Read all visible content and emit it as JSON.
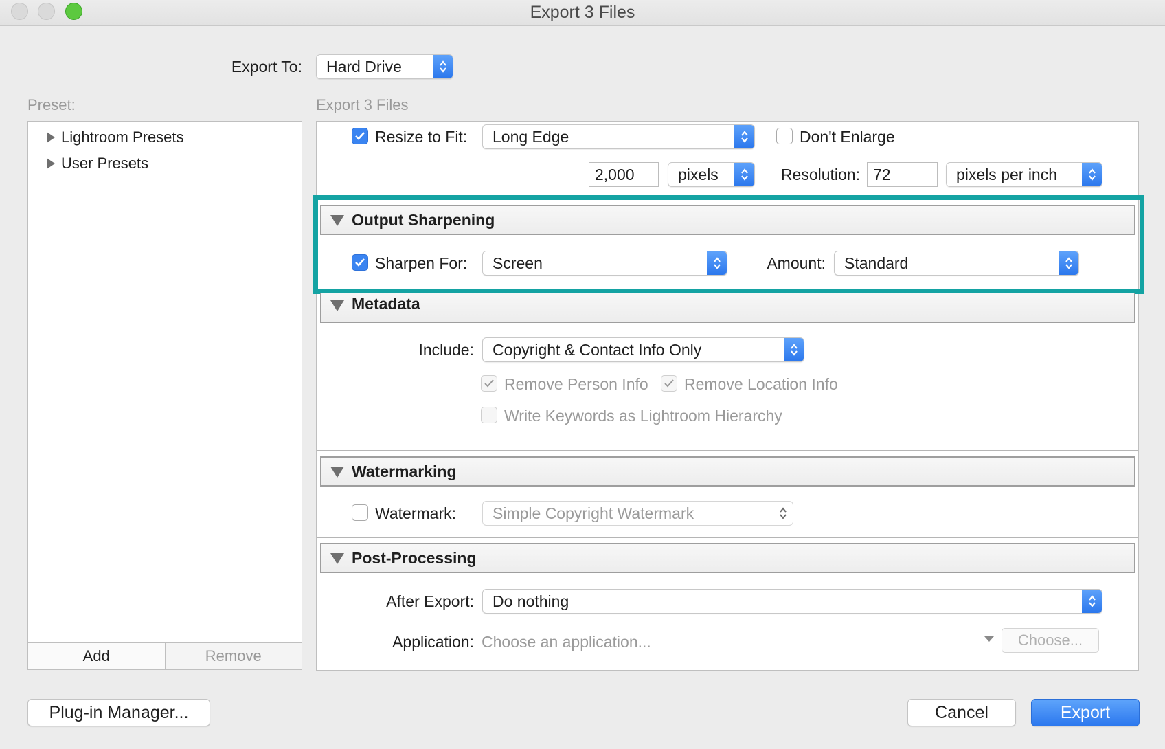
{
  "window": {
    "title": "Export 3 Files"
  },
  "export_to": {
    "label": "Export To:",
    "value": "Hard Drive"
  },
  "preset": {
    "label": "Preset:",
    "items": [
      "Lightroom Presets",
      "User Presets"
    ],
    "add_label": "Add",
    "remove_label": "Remove"
  },
  "main": {
    "header": "Export 3 Files",
    "image_sizing": {
      "resize_label": "Resize to Fit:",
      "resize_checked": true,
      "resize_mode": "Long Edge",
      "dont_enlarge_label": "Don't Enlarge",
      "dont_enlarge_checked": false,
      "size_value": "2,000",
      "size_unit": "pixels",
      "resolution_label": "Resolution:",
      "resolution_value": "72",
      "resolution_unit": "pixels per inch"
    },
    "output_sharpening": {
      "title": "Output Sharpening",
      "sharpen_for_label": "Sharpen For:",
      "sharpen_for_checked": true,
      "sharpen_for_value": "Screen",
      "amount_label": "Amount:",
      "amount_value": "Standard"
    },
    "metadata": {
      "title": "Metadata",
      "include_label": "Include:",
      "include_value": "Copyright & Contact Info Only",
      "remove_person_label": "Remove Person Info",
      "remove_location_label": "Remove Location Info",
      "write_keywords_label": "Write Keywords as Lightroom Hierarchy"
    },
    "watermarking": {
      "title": "Watermarking",
      "watermark_label": "Watermark:",
      "watermark_checked": false,
      "watermark_value": "Simple Copyright Watermark"
    },
    "post_processing": {
      "title": "Post-Processing",
      "after_export_label": "After Export:",
      "after_export_value": "Do nothing",
      "application_label": "Application:",
      "application_placeholder": "Choose an application...",
      "choose_label": "Choose..."
    }
  },
  "footer": {
    "plugin_manager_label": "Plug-in Manager...",
    "cancel_label": "Cancel",
    "export_label": "Export"
  },
  "colors": {
    "accent_blue": "#3a84f1",
    "highlight_teal": "#14a3a3",
    "traffic_green": "#5cc93f"
  }
}
